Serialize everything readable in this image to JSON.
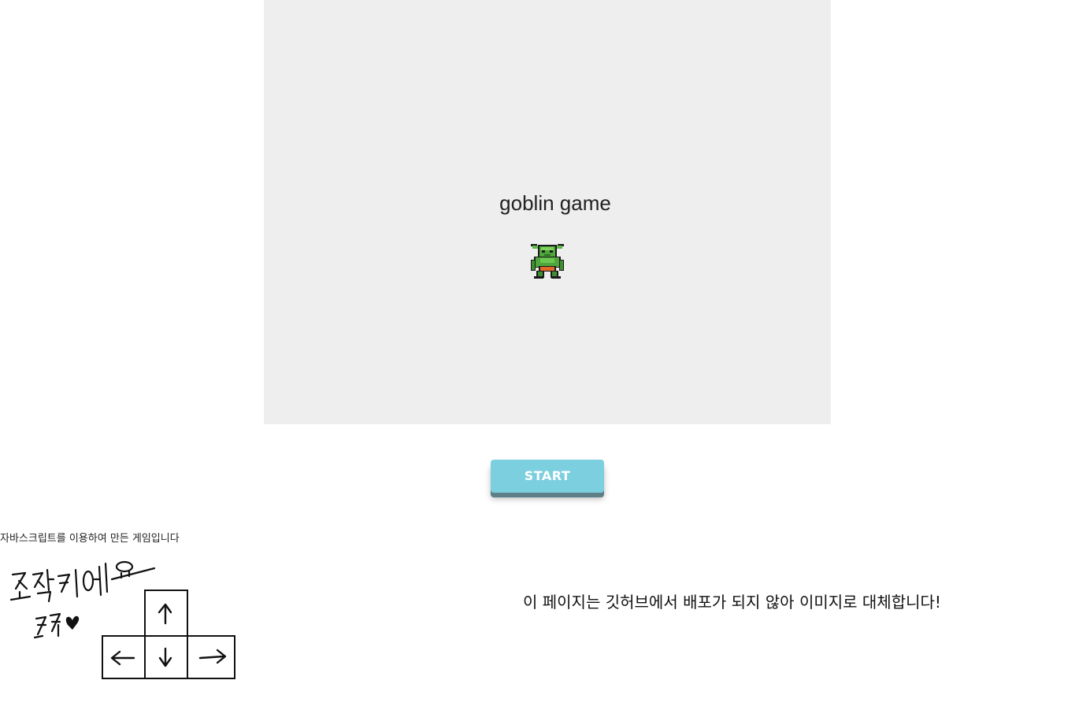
{
  "game": {
    "title": "goblin game",
    "character_icon": "goblin-sprite"
  },
  "start_button": {
    "label": "START",
    "color": "#7ccfdf"
  },
  "description": "자바스크립트를 이용하여 만든 게임입니다",
  "controls_image": {
    "handwritten_text": "조작키에요 ㅋㅋ♥",
    "keys": [
      "↑",
      "←",
      "↓",
      "→"
    ]
  },
  "notice": "이 페이지는 깃허브에서 배포가 되지 않아 이미지로 대체합니다!",
  "colors": {
    "game_background": "#eeeeee",
    "button_shadow": "#5e7f88"
  }
}
